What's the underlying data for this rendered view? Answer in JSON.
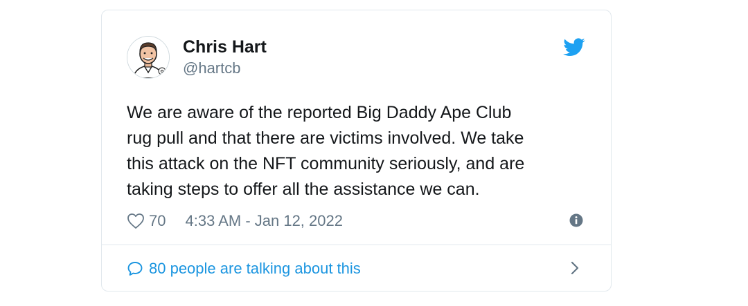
{
  "author": {
    "name": "Chris Hart",
    "handle": "@hartcb"
  },
  "tweet": {
    "text": "We are aware of the reported Big Daddy Ape Club\nrug pull and that there are victims involved. We take\nthis attack on the NFT community seriously, and are\ntaking steps to offer all the assistance we can.",
    "like_count": "70",
    "timestamp": "4:33 AM - Jan 12, 2022"
  },
  "footer": {
    "talking_label": "80 people are talking about this"
  },
  "icons": {
    "brand": "twitter-bird-icon",
    "like": "heart-icon",
    "info": "info-icon",
    "reply": "speech-bubble-icon",
    "more": "chevron-right-icon"
  },
  "colors": {
    "brand_blue": "#1da1f2",
    "link_blue": "#1b95e0",
    "text_primary": "#14171a",
    "text_secondary": "#657786",
    "border": "#e1e8ed"
  }
}
